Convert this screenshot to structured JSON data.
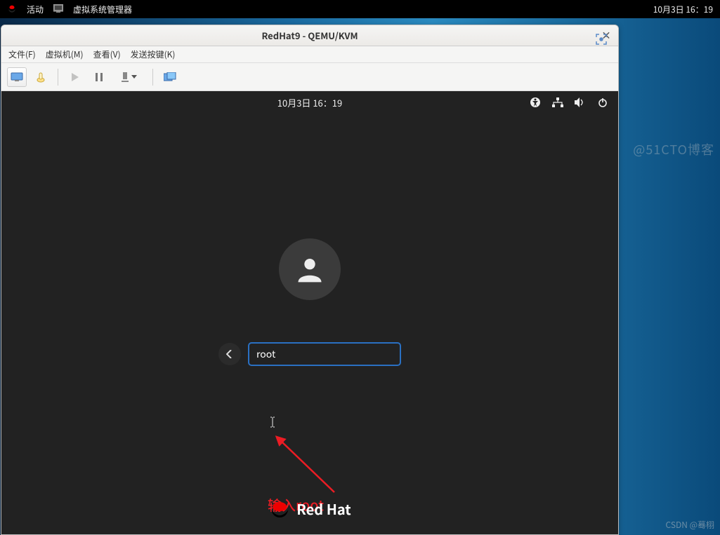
{
  "host_topbar": {
    "activities": "活动",
    "app_name": "虚拟系统管理器",
    "datetime": "10月3日 16：19"
  },
  "vm_window": {
    "title": "RedHat9 - QEMU/KVM",
    "close_glyph": "×",
    "menu": {
      "file": "文件(F)",
      "vm": "虚拟机(M)",
      "view": "查看(V)",
      "send_keys": "发送按键(K)"
    }
  },
  "guest": {
    "datetime": "10月3日 16：19",
    "username_value": "root",
    "brand": "Red Hat"
  },
  "annotation": {
    "text": "输入root"
  },
  "watermarks": {
    "top": "@51CTO博客",
    "bottom": "CSDN @蓦栩"
  }
}
